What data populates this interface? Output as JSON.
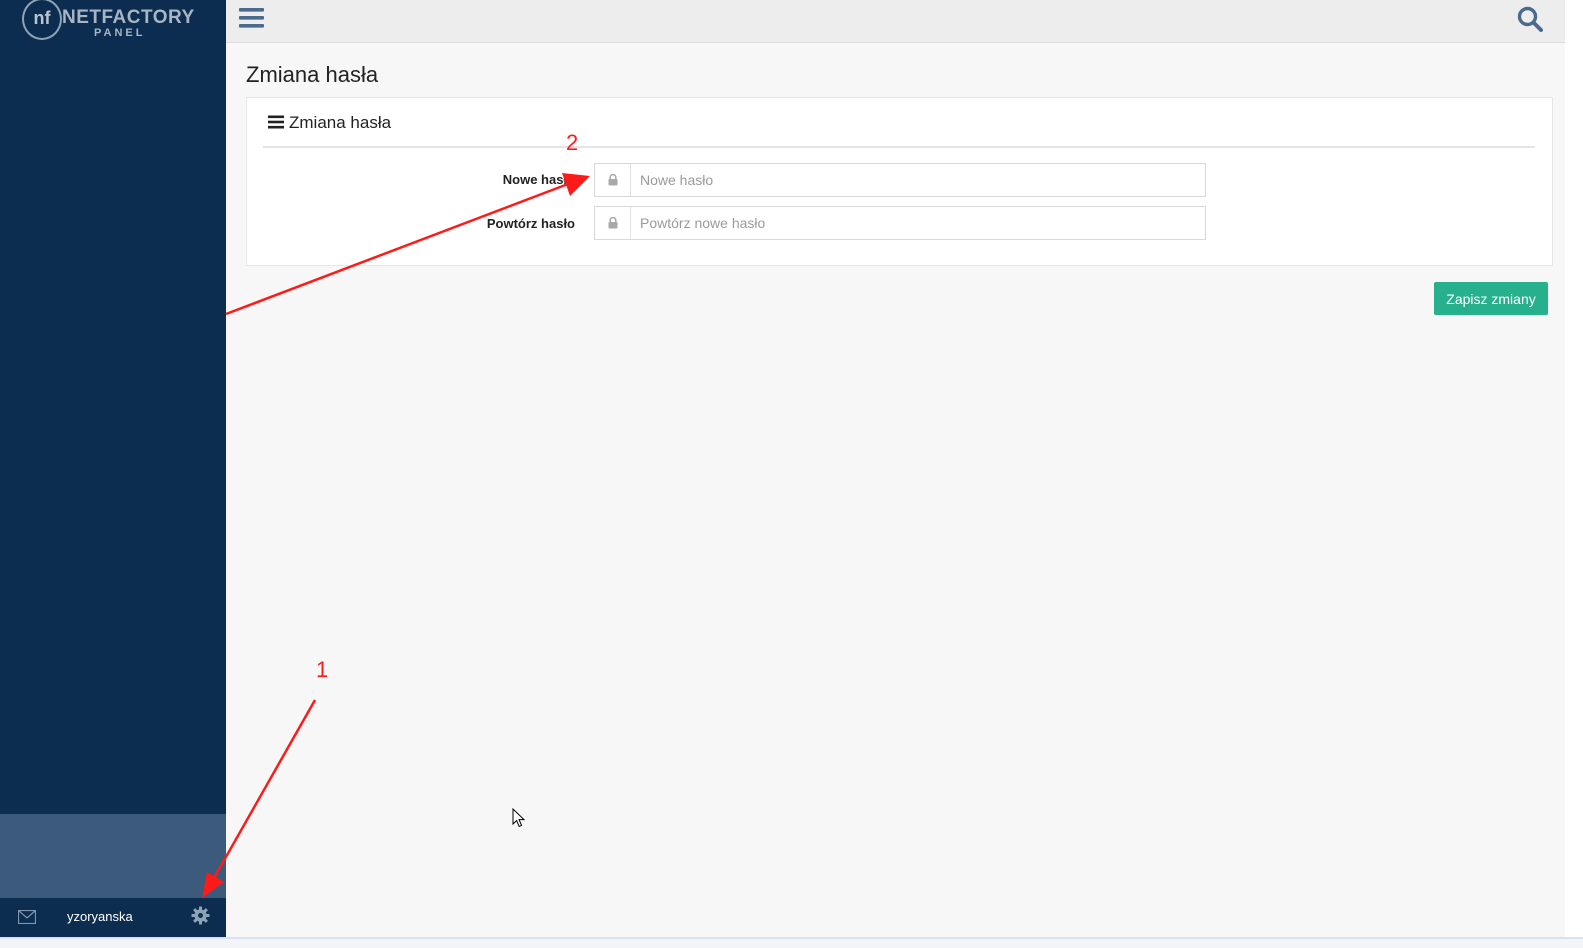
{
  "brand": {
    "mark": "nf",
    "title": "NETFACTORY",
    "subtitle": "PANEL"
  },
  "sidebar": {
    "username": "yzoryanska",
    "icons": [
      "mail-icon",
      "gear-icon"
    ]
  },
  "topbar": {
    "icons": [
      "menu-icon",
      "search-icon"
    ]
  },
  "page": {
    "title": "Zmiana hasła"
  },
  "panel": {
    "heading": "Zmiana hasła",
    "fields": [
      {
        "label": "Nowe hasło",
        "placeholder": "Nowe hasło",
        "value": "",
        "icon": "lock-icon"
      },
      {
        "label": "Powtórz hasło",
        "placeholder": "Powtórz nowe hasło",
        "value": "",
        "icon": "lock-icon"
      }
    ]
  },
  "actions": {
    "save_label": "Zapisz zmiany"
  },
  "annotations": {
    "first": "1",
    "second": "2",
    "color": "#ff1a1a"
  },
  "colors": {
    "sidebar": "#0c2d4f",
    "accent": "#26b08c"
  }
}
